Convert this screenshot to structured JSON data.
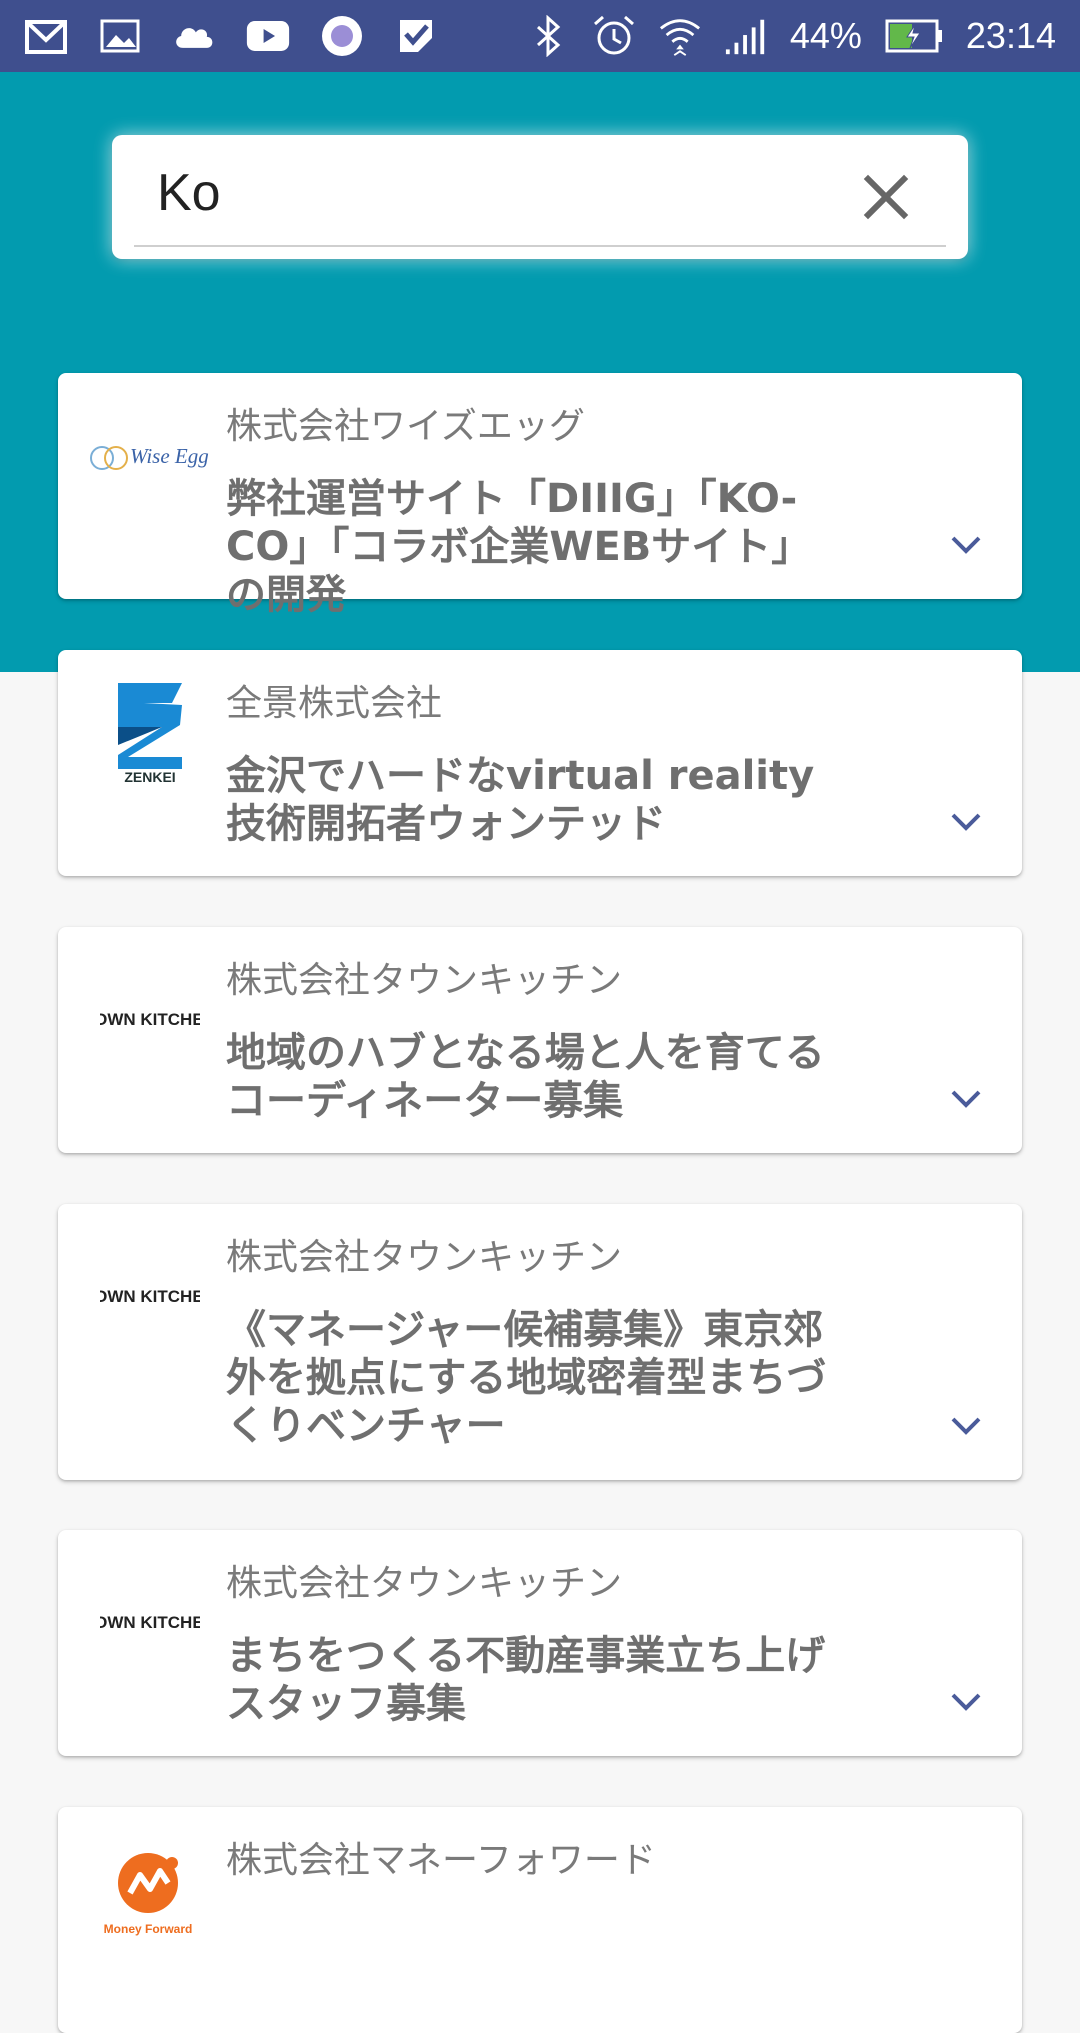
{
  "status_bar": {
    "left_icons": [
      "mail-icon",
      "gallery-icon",
      "cloud-icon",
      "youtube-icon",
      "circle-app-icon",
      "check-app-icon"
    ],
    "right_icons": [
      "bluetooth-icon",
      "alarm-icon",
      "wifi-icon",
      "signal-icon"
    ],
    "battery": "44%",
    "time": "23:14"
  },
  "search": {
    "value": "Ko",
    "placeholder": ""
  },
  "colors": {
    "status_bar": "#3f4f8e",
    "header": "#029baf",
    "chevron": "#4a5b9a"
  },
  "cards": [
    {
      "company": "株式会社ワイズエッグ",
      "title": "弊社運営サイト「DIIIG」「KO-CO」「コラボ企業WEBサイト」の開発",
      "logo": "Wise Egg"
    },
    {
      "company": "全景株式会社",
      "title": "金沢でハードなvirtual reality技術開拓者ウォンテッド",
      "logo": "ZENKEI"
    },
    {
      "company": "株式会社タウンキッチン",
      "title": "地域のハブとなる場と人を育てるコーディネーター募集",
      "logo": "TOWN KITCHEN"
    },
    {
      "company": "株式会社タウンキッチン",
      "title": "《マネージャー候補募集》東京郊外を拠点にする地域密着型まちづくりベンチャー",
      "logo": "TOWN KITCHEN"
    },
    {
      "company": "株式会社タウンキッチン",
      "title": "まちをつくる不動産事業立ち上げスタッフ募集",
      "logo": "TOWN KITCHEN"
    },
    {
      "company": "株式会社マネーフォワード",
      "title": "",
      "logo": "Money Forward"
    }
  ]
}
